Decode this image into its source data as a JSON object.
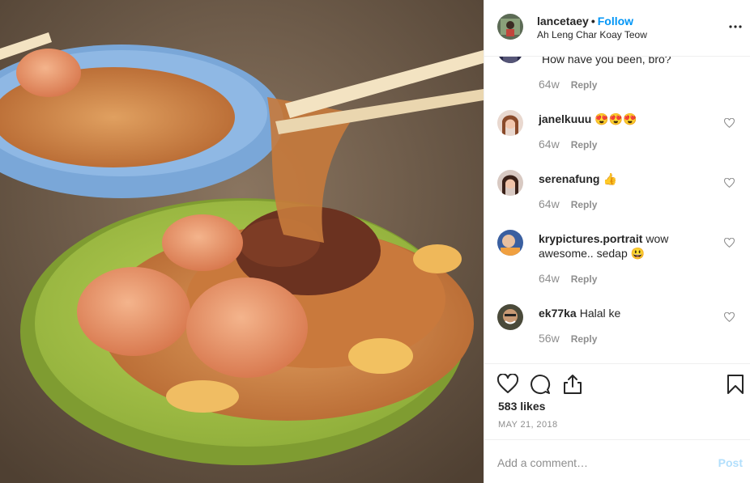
{
  "photo": {
    "alt_subject": "char-koay-teow-photo"
  },
  "header": {
    "username": "lancetaey",
    "separator": "•",
    "follow_label": "Follow",
    "location": "Ah Leng Char Koay Teow",
    "more_icon": "more-horizontal-icon"
  },
  "comments": [
    {
      "username": "",
      "text": "How have you been, bro?",
      "age": "64w",
      "reply_label": "Reply",
      "has_heart": false
    },
    {
      "username": "janelkuuu",
      "text": "😍😍😍",
      "age": "64w",
      "reply_label": "Reply",
      "has_heart": true
    },
    {
      "username": "serenafung",
      "text": "👍",
      "age": "64w",
      "reply_label": "Reply",
      "has_heart": true
    },
    {
      "username": "krypictures.portrait",
      "text": "wow awesome.. sedap 😃",
      "age": "64w",
      "reply_label": "Reply",
      "has_heart": true
    },
    {
      "username": "ek77ka",
      "text": "Halal ke",
      "age": "56w",
      "reply_label": "Reply",
      "has_heart": true
    }
  ],
  "actions": {
    "icons": [
      "heart-icon",
      "comment-icon",
      "share-icon",
      "bookmark-icon"
    ],
    "likes": "583 likes",
    "date": "MAY 21, 2018"
  },
  "composer": {
    "placeholder": "Add a comment…",
    "post_label": "Post"
  },
  "colors": {
    "link_blue": "#0095f6",
    "post_disabled": "#b2dffc",
    "muted": "#8e8e8e",
    "text": "#262626"
  }
}
